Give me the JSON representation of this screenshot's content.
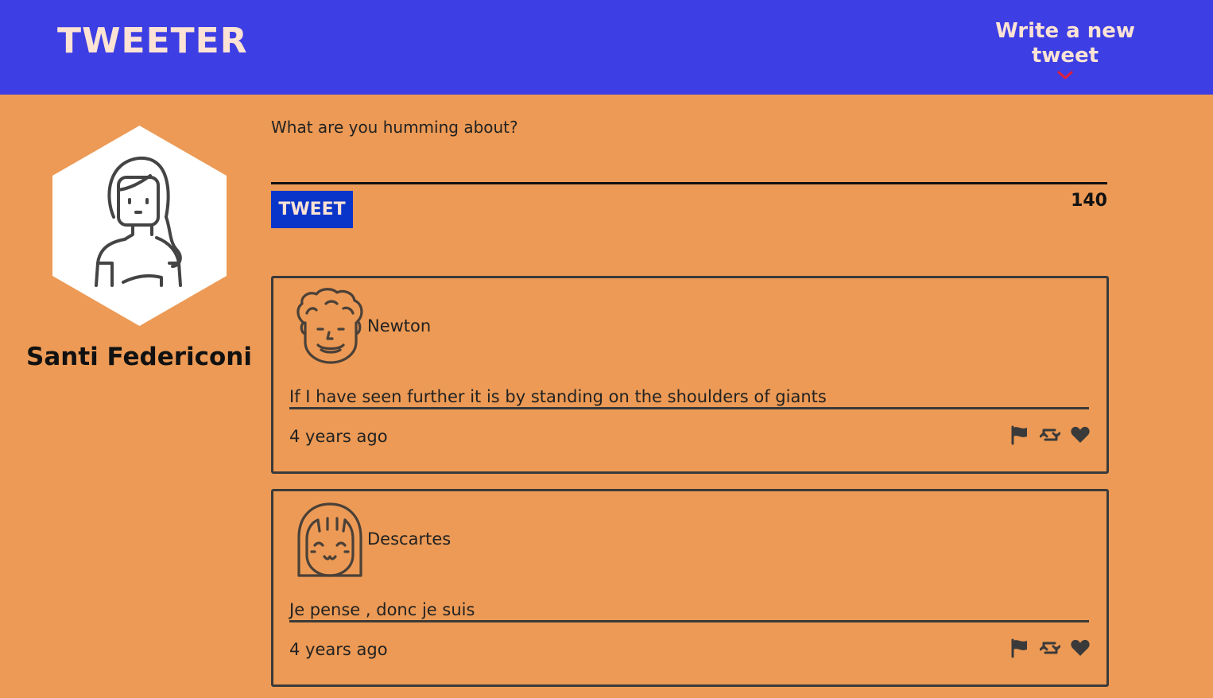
{
  "header": {
    "logo": "TWEETER",
    "new_tweet_label": "Write a new tweet"
  },
  "profile": {
    "name": "Santi Federiconi"
  },
  "composer": {
    "placeholder": "What are you humming about?",
    "button_label": "TWEET",
    "char_count": "140"
  },
  "tweets": [
    {
      "user": "Newton",
      "text": "If I have seen further it is by standing on the shoulders of giants",
      "time": "4 years ago",
      "avatar_icon": "curly-hair-man-avatar-icon"
    },
    {
      "user": "Descartes",
      "text": "Je pense , donc je suis",
      "time": "4 years ago",
      "avatar_icon": "bob-hair-smiling-avatar-icon"
    }
  ],
  "icons": [
    "flag-icon",
    "retweet-icon",
    "heart-icon",
    "chevron-down-icon"
  ],
  "colors": {
    "header_bg": "#3d3ee3",
    "page_bg": "#ec9a55",
    "tweet_button_bg": "#0a35c9",
    "logo_text": "#fde3d4",
    "chevron": "#e0203a"
  }
}
